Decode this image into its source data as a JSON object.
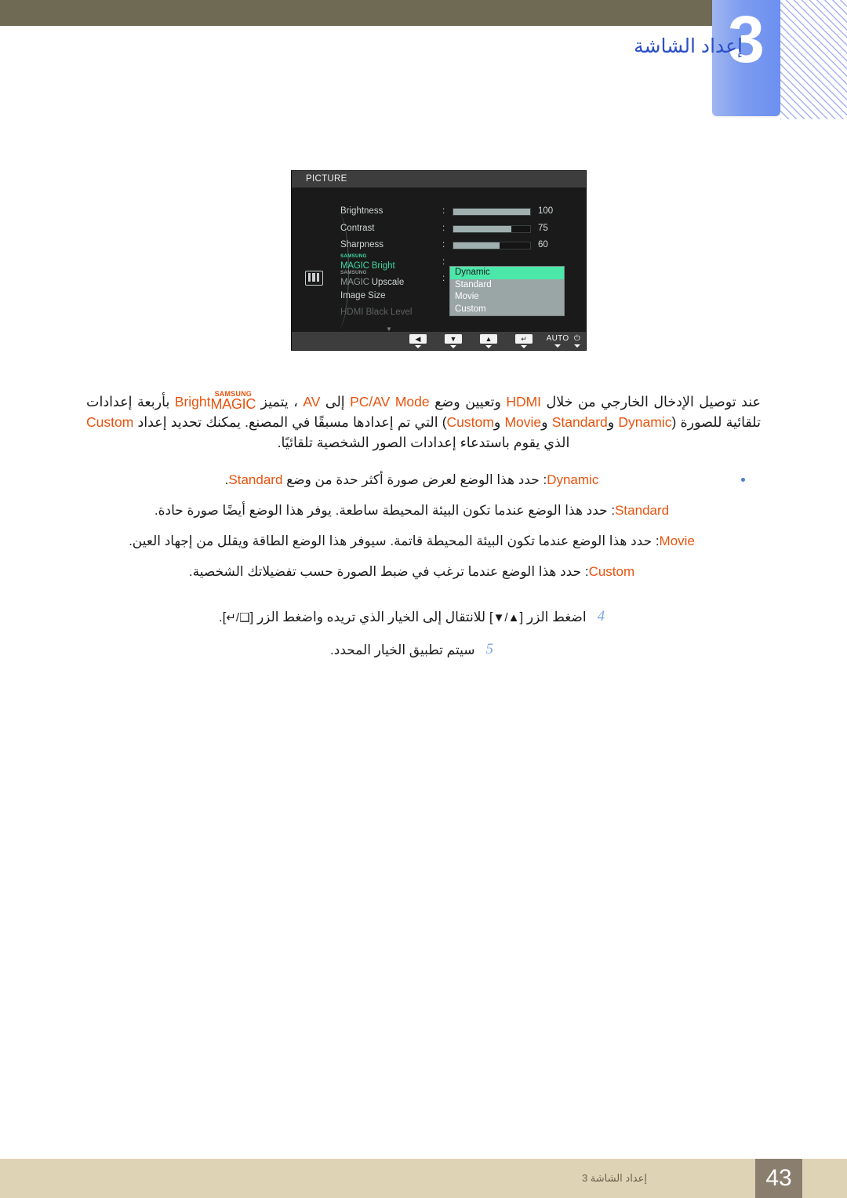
{
  "header": {
    "chapter_number": "3",
    "title": "إعداد الشاشة"
  },
  "osd": {
    "title": "PICTURE",
    "side_icon": "picture-icon",
    "rows": [
      {
        "label": "Brightness",
        "colon": ":",
        "value": "100",
        "fill_pct": 100
      },
      {
        "label": "Contrast",
        "colon": ":",
        "value": "75",
        "fill_pct": 75
      },
      {
        "label": "Sharpness",
        "colon": ":",
        "value": "60",
        "fill_pct": 60
      },
      {
        "label_brand": "SAMSUNG",
        "label_magic": "MAGIC",
        "label_suffix": "Bright",
        "colon": ":"
      },
      {
        "label_brand": "SAMSUNG",
        "label_magic": "MAGIC",
        "label_suffix": "Upscale",
        "colon": ":"
      },
      {
        "label": "Image Size"
      },
      {
        "label": "HDMI Black Level"
      }
    ],
    "scroll_arrow": "▼",
    "dropdown": {
      "selected": "Dynamic",
      "options": [
        "Dynamic",
        "Standard",
        "Movie",
        "Custom"
      ]
    },
    "buttons": [
      {
        "name": "left-button",
        "glyph": "◀",
        "type": "key"
      },
      {
        "name": "down-button",
        "glyph": "▼",
        "type": "key"
      },
      {
        "name": "up-button",
        "glyph": "▲",
        "type": "key"
      },
      {
        "name": "enter-button",
        "glyph": "↵",
        "type": "key"
      },
      {
        "name": "auto-button",
        "glyph": "AUTO",
        "type": "text"
      },
      {
        "name": "power-button",
        "glyph": "⏻",
        "type": "text"
      }
    ]
  },
  "intro": {
    "line1_a": "عند توصيل الإدخال الخارجي من خلال ",
    "hdmi": "HDMI",
    "line1_b": " وتعيين وضع ",
    "pcav": "PC/AV Mode",
    "line1_c": " إلى ",
    "av": "AV",
    "line1_d": " ، يتميز ",
    "magic_brand": "SAMSUNG",
    "magic_word": "MAGIC",
    "magic_suffix": "Bright",
    "line1_e": " بأربعة إعدادات تلقائية للصورة (",
    "dynamic": "Dynamic",
    "sep1": " و",
    "standard": "Standard",
    "sep2": " و",
    "movie": "Movie",
    "sep3": " و",
    "custom": "Custom",
    "line1_f": ") التي تم إعدادها مسبقًا في المصنع. يمكنك تحديد إعداد ",
    "custom2": "Custom",
    "line1_g": " الذي يقوم باستدعاء إعدادات الصور الشخصية تلقائيًا."
  },
  "bullets": [
    {
      "term": "Dynamic",
      "text_before": ": حدد هذا الوضع لعرض صورة أكثر حدة من وضع ",
      "term2": "Standard",
      "text_after": "."
    },
    {
      "term": "Standard",
      "text_before": ": حدد هذا الوضع عندما تكون البيئة المحيطة ساطعة. يوفر هذا الوضع أيضًا صورة حادة.",
      "term2": "",
      "text_after": ""
    },
    {
      "term": "Movie",
      "text_before": ": حدد هذا الوضع عندما تكون البيئة المحيطة قاتمة. سيوفر هذا الوضع الطاقة ويقلل من إجهاد العين.",
      "term2": "",
      "text_after": ""
    },
    {
      "term": "Custom",
      "text_before": ": حدد هذا الوضع عندما ترغب في ضبط الصورة حسب تفضيلاتك الشخصية.",
      "term2": "",
      "text_after": ""
    }
  ],
  "steps": [
    {
      "num": "4",
      "text_a": "اضغط الزر [",
      "key1": "▲/▼",
      "text_b": "] للانتقال إلى الخيار الذي تريده واضغط الزر [",
      "key2": "❑/↵",
      "text_c": "]."
    },
    {
      "num": "5",
      "text_a": "سيتم تطبيق الخيار المحدد.",
      "key1": "",
      "text_b": "",
      "key2": "",
      "text_c": ""
    }
  ],
  "footer": {
    "page_number": "43",
    "chapter_label": "إعداد الشاشة 3"
  },
  "colors": {
    "accent_orange": "#e8530e",
    "header_blue": "#2b4fc6",
    "tab_blue": "#7c9cf0",
    "olive": "#6e6a54",
    "footer_tan": "#ded3b4",
    "footer_page_box": "#8a7f6e",
    "osd_highlight": "#4ce8aa",
    "osd_magic_green": "#3fd9a0"
  }
}
